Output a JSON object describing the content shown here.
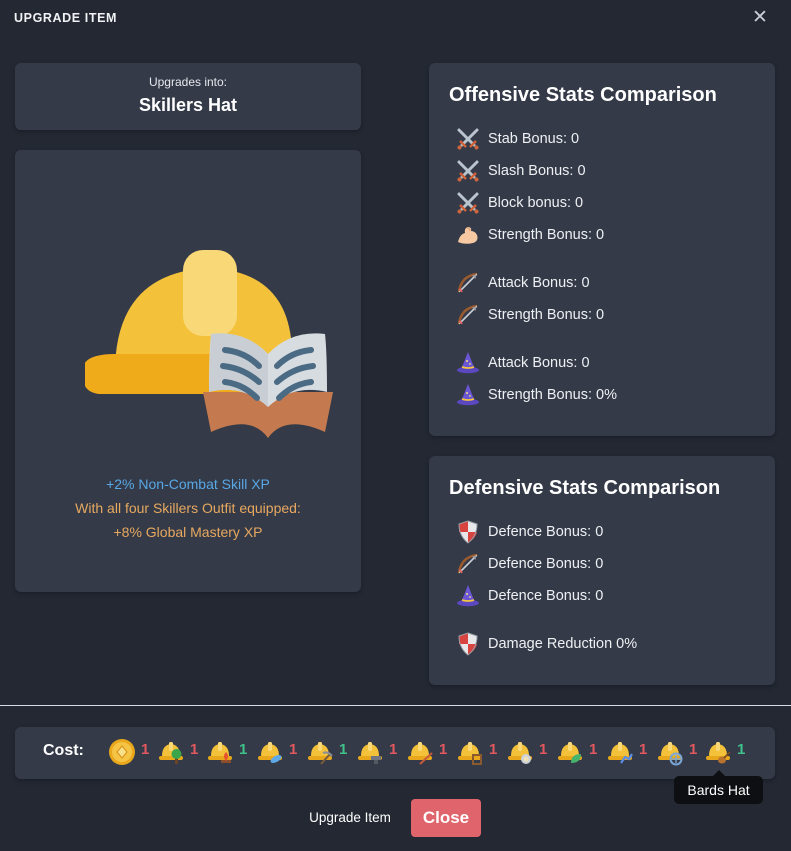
{
  "window": {
    "title": "UPGRADE ITEM",
    "close_glyph": "✕"
  },
  "upgrade": {
    "label": "Upgrades into:",
    "item_name": "Skillers Hat"
  },
  "item": {
    "icon": "hardhat-with-book-icon",
    "desc_line1": "+2% Non-Combat Skill XP",
    "desc_line2": "With all four Skillers Outfit equipped:",
    "desc_line3": "+8% Global Mastery XP",
    "colors": {
      "blue": "#58a8e6",
      "orange": "#e7a85f"
    }
  },
  "offense": {
    "title": "Offensive Stats Comparison",
    "stats": [
      {
        "icon": "crossed-swords-icon",
        "label": "Stab Bonus: 0"
      },
      {
        "icon": "crossed-swords-icon",
        "label": "Slash Bonus: 0"
      },
      {
        "icon": "crossed-swords-icon",
        "label": "Block bonus: 0"
      },
      {
        "icon": "flexed-arm-icon",
        "label": "Strength Bonus: 0"
      },
      {
        "icon": "bow-arrow-icon",
        "label": "Attack Bonus: 0"
      },
      {
        "icon": "bow-arrow-icon",
        "label": "Strength Bonus: 0"
      },
      {
        "icon": "wizard-hat-icon",
        "label": "Attack Bonus: 0"
      },
      {
        "icon": "wizard-hat-icon",
        "label": "Strength Bonus: 0%"
      }
    ]
  },
  "defense": {
    "title": "Defensive Stats Comparison",
    "stats": [
      {
        "icon": "shield-icon",
        "label": "Defence Bonus: 0"
      },
      {
        "icon": "bow-arrow-icon",
        "label": "Defence Bonus: 0"
      },
      {
        "icon": "wizard-hat-icon",
        "label": "Defence Bonus: 0"
      },
      {
        "icon": "shield-icon",
        "label": "Damage Reduction 0%"
      }
    ]
  },
  "cost": {
    "label": "Cost:",
    "items": [
      {
        "icon": "gold-coin-icon",
        "qty": "1",
        "qty_color": "red"
      },
      {
        "icon": "woodcutting-hat-icon",
        "qty": "1",
        "qty_color": "red"
      },
      {
        "icon": "firemaking-hat-icon",
        "qty": "1",
        "qty_color": "green"
      },
      {
        "icon": "fishing-hat-icon",
        "qty": "1",
        "qty_color": "red"
      },
      {
        "icon": "mining-hat-icon",
        "qty": "1",
        "qty_color": "green"
      },
      {
        "icon": "smithing-hat-icon",
        "qty": "1",
        "qty_color": "red"
      },
      {
        "icon": "fletching-hat-icon",
        "qty": "1",
        "qty_color": "red"
      },
      {
        "icon": "crafting-hat-icon",
        "qty": "1",
        "qty_color": "red"
      },
      {
        "icon": "cooking-hat-icon",
        "qty": "1",
        "qty_color": "red"
      },
      {
        "icon": "herblore-hat-icon",
        "qty": "1",
        "qty_color": "red"
      },
      {
        "icon": "agility-hat-icon",
        "qty": "1",
        "qty_color": "red"
      },
      {
        "icon": "summoning-hat-icon",
        "qty": "1",
        "qty_color": "red"
      },
      {
        "icon": "bards-hat-icon",
        "qty": "1",
        "qty_color": "green"
      }
    ],
    "colors": {
      "red": "#e2585f",
      "green": "#3fc18a"
    }
  },
  "tooltip": {
    "text": "Bards Hat"
  },
  "footer": {
    "upgrade_label": "Upgrade Item",
    "close_label": "Close"
  }
}
